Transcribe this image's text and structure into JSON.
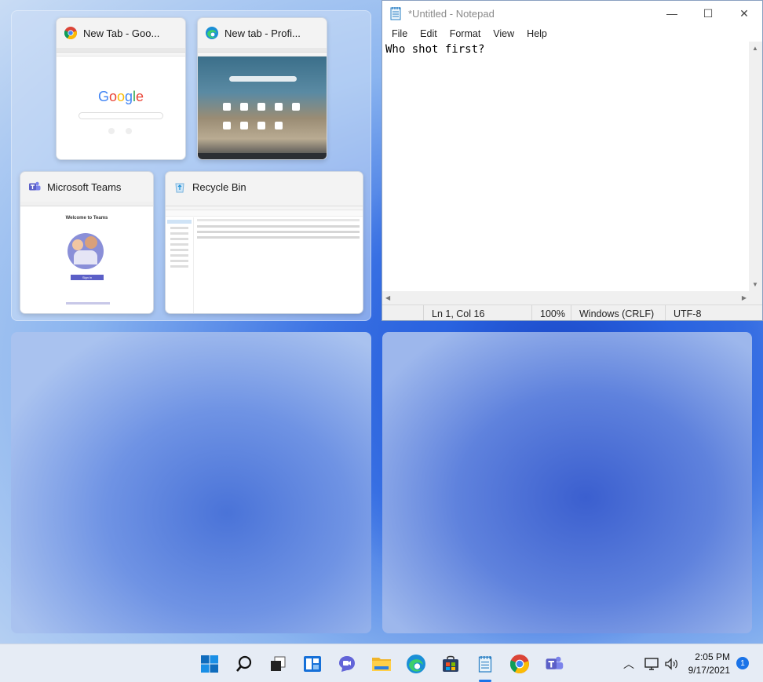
{
  "snap_assist": {
    "windows": [
      {
        "title": "New Tab - Goo...",
        "app": "chrome"
      },
      {
        "title": "New tab - Profi...",
        "app": "edge"
      },
      {
        "title": "Microsoft Teams",
        "app": "teams"
      },
      {
        "title": "Recycle Bin",
        "app": "recycle-bin"
      }
    ],
    "chrome_preview": {
      "logo": "Google"
    },
    "teams_preview": {
      "welcome": "Welcome to Teams",
      "sign_in": "Sign in"
    }
  },
  "notepad": {
    "title": "*Untitled - Notepad",
    "menu": [
      "File",
      "Edit",
      "Format",
      "View",
      "Help"
    ],
    "content": "Who shot first?",
    "status": {
      "position": "Ln 1, Col 16",
      "zoom": "100%",
      "line_ending": "Windows (CRLF)",
      "encoding": "UTF-8"
    },
    "controls": {
      "minimize": "—",
      "maximize": "☐",
      "close": "✕"
    }
  },
  "taskbar": {
    "clock_time": "2:05 PM",
    "clock_date": "9/17/2021",
    "notification_count": "1"
  },
  "colors": {
    "google_blue": "#4285F4",
    "google_red": "#EA4335",
    "google_yellow": "#FBBC05",
    "google_green": "#34A853",
    "teams_purple": "#5b5fc7",
    "accent": "#1a73e8"
  }
}
